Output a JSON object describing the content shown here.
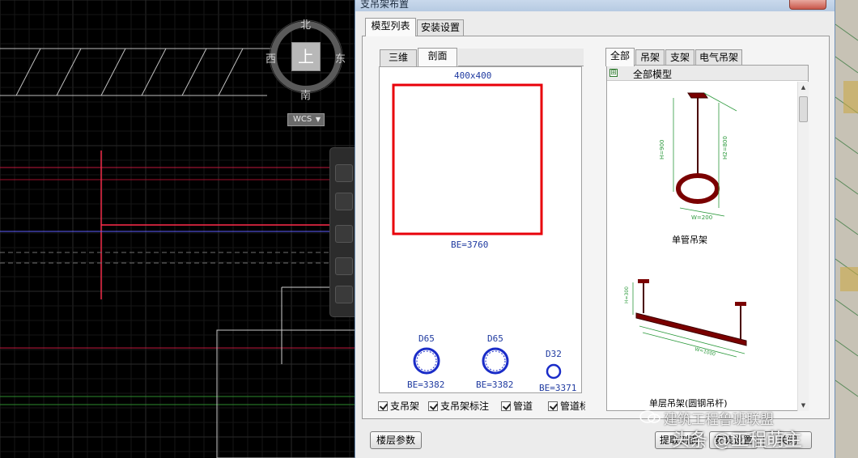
{
  "dialog": {
    "title": "支吊架布置",
    "main_tabs": [
      {
        "label": "模型列表",
        "active": true
      },
      {
        "label": "安装设置",
        "active": false
      }
    ],
    "view_tabs": [
      {
        "label": "三维",
        "active": false
      },
      {
        "label": "剖面",
        "active": true
      }
    ],
    "section": {
      "duct_size": "400x400",
      "duct_elevation": "BE=3760",
      "pipes": [
        {
          "dia": "D65",
          "elevation": "BE=3382"
        },
        {
          "dia": "D65",
          "elevation": "BE=3382"
        },
        {
          "dia": "D32",
          "elevation": "BE=3371"
        }
      ]
    },
    "category_tabs": [
      {
        "label": "全部",
        "active": true
      },
      {
        "label": "吊架",
        "active": false
      },
      {
        "label": "支架",
        "active": false
      },
      {
        "label": "电气吊架",
        "active": false
      }
    ],
    "tree_root": "全部模型",
    "models": [
      {
        "caption": "单管吊架",
        "dims": [
          "H=900",
          "H2=800",
          "W=200"
        ]
      },
      {
        "caption": "单层吊架(圆钢吊杆)",
        "dims": [
          "H=300",
          "W=1000"
        ]
      }
    ],
    "checkboxes": [
      {
        "label": "支吊架",
        "checked": true
      },
      {
        "label": "支吊架标注",
        "checked": true
      },
      {
        "label": "管道",
        "checked": true
      },
      {
        "label": "管道标注",
        "checked": true
      }
    ],
    "buttons": {
      "floor_params": "楼层参数",
      "extract_section": "提取剖面",
      "install": "安装设置",
      "close": "关闭"
    }
  },
  "view_cube": {
    "north": "北",
    "south": "南",
    "east": "东",
    "west": "西",
    "top": "上",
    "coord_system": "WCS"
  },
  "watermark": {
    "line1": "建筑工程鲁班联盟",
    "line2": "头条 @工程萌主"
  },
  "colors": {
    "duct_outline": "#e8000a",
    "pipe_outline": "#1a2cc8",
    "dimension_text": "#1f3aa0",
    "model_steel": "#7a0000",
    "cad_background": "#000000"
  }
}
